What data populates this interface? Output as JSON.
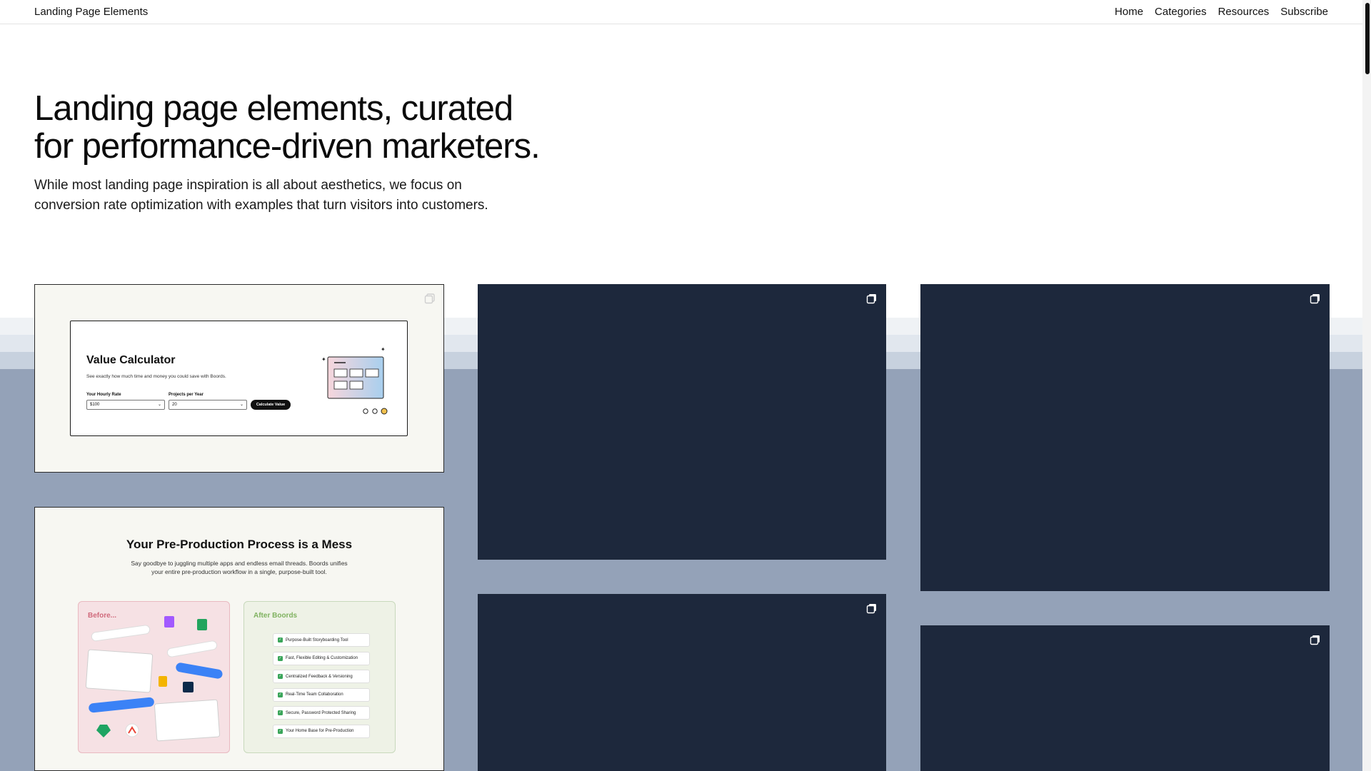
{
  "header": {
    "brand": "Landing Page Elements",
    "nav": [
      "Home",
      "Categories",
      "Resources",
      "Subscribe"
    ]
  },
  "hero": {
    "title_line1": "Landing page elements, curated",
    "title_line2": "for performance-driven marketers.",
    "subtitle_line1": "While most landing page inspiration is all about aesthetics, we focus on",
    "subtitle_line2": "conversion rate optimization with examples that turn visitors into customers."
  },
  "cards": {
    "value_calculator": {
      "title": "Value Calculator",
      "description": "See exactly how much time and money you could save with Boords.",
      "hourly_rate_label": "Your Hourly Rate",
      "hourly_rate_value": "$100",
      "projects_label": "Projects per Year",
      "projects_value": "20",
      "button": "Calculate Value"
    },
    "preproduction": {
      "title": "Your Pre-Production Process is a Mess",
      "subtitle_line1": "Say goodbye to juggling multiple apps and endless email threads. Boords unifies",
      "subtitle_line2": "your entire pre-production workflow in a single, purpose-built tool.",
      "before_title": "Before...",
      "after_title": "After Boords",
      "after_items": [
        "Purpose-Built Storyboarding Tool",
        "Fast, Flexible Editing & Customization",
        "Centralized Feedback & Versioning",
        "Real-Time Team Collaboration",
        "Secure, Password Protected Sharing",
        "Your Home Base for Pre-Production"
      ]
    }
  },
  "colors": {
    "card_dark": "#1d283c",
    "card_light": "#f7f7f2",
    "band_bg": "#94a2b8",
    "accent_pink": "#d06a7c",
    "accent_green": "#7fb25f"
  }
}
